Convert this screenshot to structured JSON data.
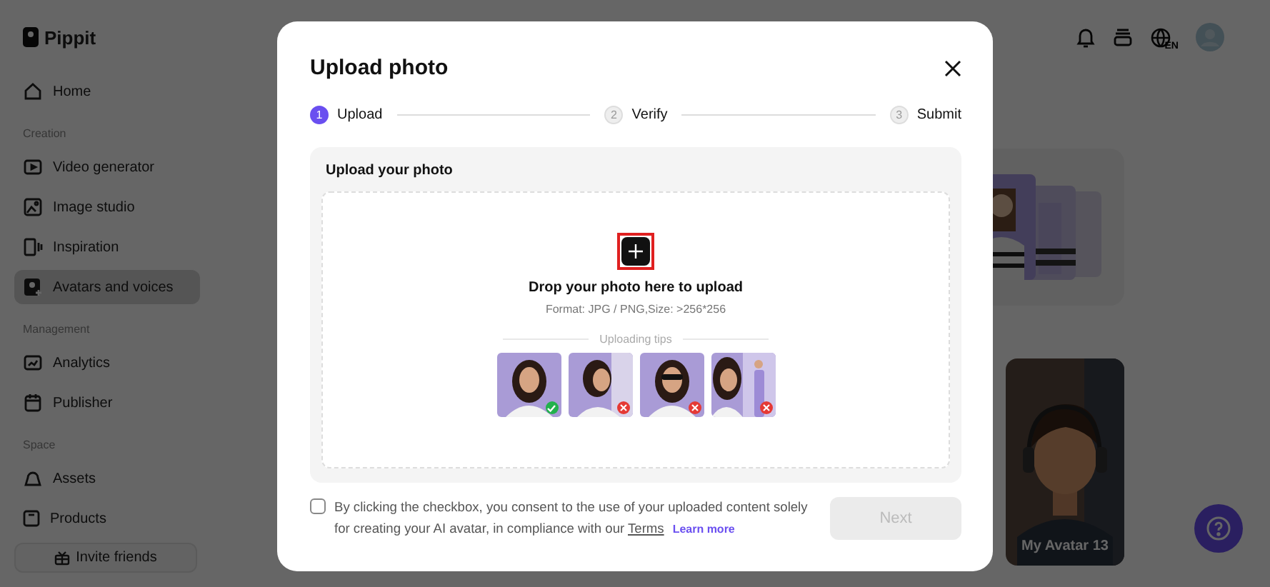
{
  "sidebar": {
    "logo": "Pippit",
    "sections": [
      {
        "items": [
          {
            "label": "Home",
            "selected": false
          }
        ]
      },
      {
        "title": "Creation",
        "items": [
          {
            "label": "Video generator",
            "selected": false
          },
          {
            "label": "Image studio",
            "selected": false
          },
          {
            "label": "Inspiration",
            "selected": false
          },
          {
            "label": "Avatars and voices",
            "selected": true
          }
        ]
      },
      {
        "title": "Management",
        "items": [
          {
            "label": "Analytics",
            "selected": false
          },
          {
            "label": "Publisher",
            "selected": false
          }
        ]
      },
      {
        "title": "Space",
        "items": [
          {
            "label": "Assets",
            "selected": false
          },
          {
            "label": "Products",
            "selected": false
          }
        ]
      }
    ],
    "invite_button": "Invite friends"
  },
  "topbar": {
    "language": "EN"
  },
  "avatar_card": {
    "label": "My Avatar 13"
  },
  "modal": {
    "title": "Upload photo",
    "steps": [
      {
        "number": "1",
        "label": "Upload",
        "selected": true
      },
      {
        "number": "2",
        "label": "Verify",
        "selected": false
      },
      {
        "number": "3",
        "label": "Submit",
        "selected": false
      }
    ],
    "panel_title": "Upload your photo",
    "drop_text": "Drop your photo here to upload",
    "format_text": "Format: JPG / PNG,Size: >256*256",
    "tips_title": "Uploading tips",
    "tips": [
      {
        "approved": true
      },
      {
        "approved": false
      },
      {
        "approved": false
      },
      {
        "approved": false
      }
    ],
    "consent": {
      "checked": false,
      "text": "By clicking the checkbox, you consent to the use of your uploaded content solely for creating your AI avatar, in compliance with our",
      "terms_link": "Terms",
      "learn_more": "Learn more"
    },
    "next_button": {
      "label": "Next",
      "disabled": true
    }
  }
}
